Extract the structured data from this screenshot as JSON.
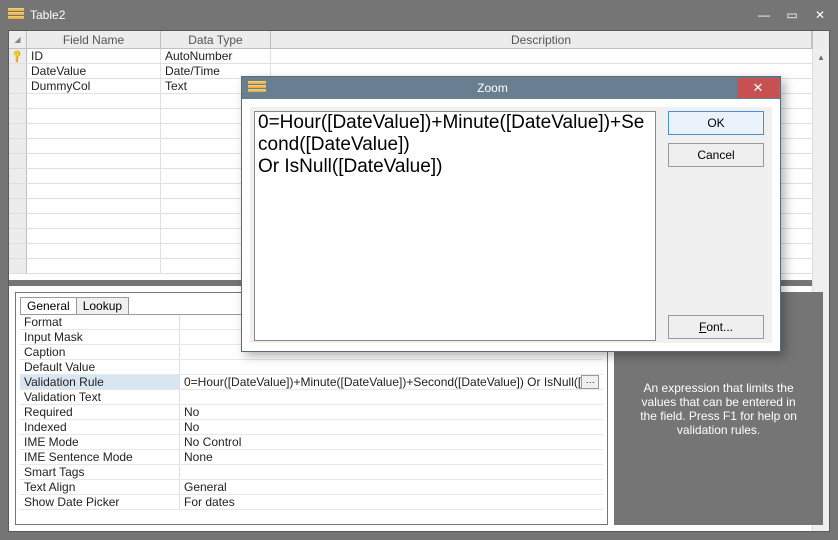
{
  "window": {
    "title": "Table2",
    "columns": {
      "field": "Field Name",
      "type": "Data Type",
      "desc": "Description"
    },
    "rows": [
      {
        "pk": true,
        "field": "ID",
        "type": "AutoNumber",
        "desc": ""
      },
      {
        "pk": false,
        "field": "DateValue",
        "type": "Date/Time",
        "desc": ""
      },
      {
        "pk": false,
        "field": "DummyCol",
        "type": "Text",
        "desc": ""
      }
    ]
  },
  "zoom": {
    "title": "Zoom",
    "expression": "0=Hour([DateValue])+Minute([DateValue])+Second([DateValue])\nOr IsNull([DateValue])",
    "ok": "OK",
    "cancel": "Cancel",
    "font": "Font..."
  },
  "tabs": {
    "general": "General",
    "lookup": "Lookup"
  },
  "props": [
    {
      "label": "Format",
      "value": ""
    },
    {
      "label": "Input Mask",
      "value": ""
    },
    {
      "label": "Caption",
      "value": ""
    },
    {
      "label": "Default Value",
      "value": ""
    },
    {
      "label": "Validation Rule",
      "value": "0=Hour([DateValue])+Minute([DateValue])+Second([DateValue]) Or IsNull([",
      "selected": true,
      "builder": true
    },
    {
      "label": "Validation Text",
      "value": ""
    },
    {
      "label": "Required",
      "value": "No"
    },
    {
      "label": "Indexed",
      "value": "No"
    },
    {
      "label": "IME Mode",
      "value": "No Control"
    },
    {
      "label": "IME Sentence Mode",
      "value": "None"
    },
    {
      "label": "Smart Tags",
      "value": ""
    },
    {
      "label": "Text Align",
      "value": "General"
    },
    {
      "label": "Show Date Picker",
      "value": "For dates"
    }
  ],
  "help": "An expression that limits the values that can be entered in the field. Press F1 for help on validation rules."
}
